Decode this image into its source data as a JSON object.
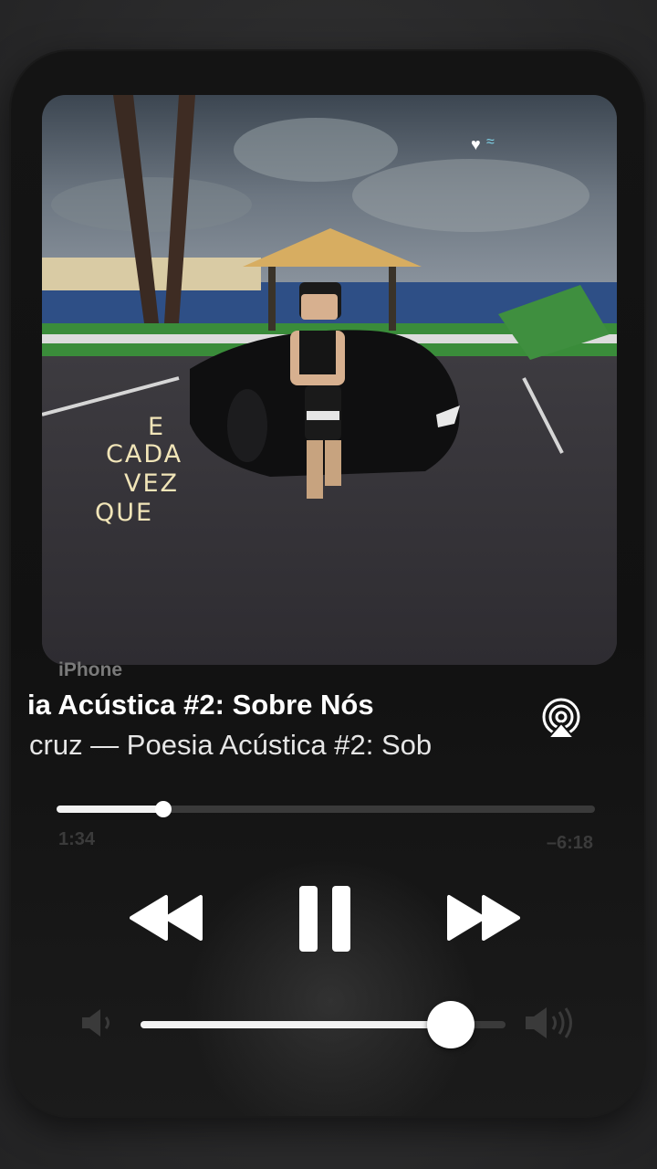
{
  "artwork": {
    "lyric_lines": [
      "E",
      "CADA",
      "VEZ",
      "QUE"
    ],
    "sticker_icons": [
      "heart-icon",
      "wave-icon"
    ]
  },
  "now_playing": {
    "device_label": "iPhone",
    "title": "ia Acústica #2: Sobre Nós",
    "subtitle": "cruz — Poesia Acústica #2: Sob"
  },
  "progress": {
    "elapsed": "1:34",
    "remaining": "–6:18",
    "fraction": 0.198
  },
  "controls": {
    "rewind_icon": "backward-icon",
    "pause_icon": "pause-icon",
    "forward_icon": "forward-icon",
    "airplay_icon": "airplay-icon"
  },
  "volume": {
    "level": 0.85,
    "min_icon": "speaker-low-icon",
    "max_icon": "speaker-high-icon"
  },
  "colors": {
    "accent": "#ffffff",
    "lyric": "#f1e5b8",
    "muted_text": "#3b3b3b"
  }
}
